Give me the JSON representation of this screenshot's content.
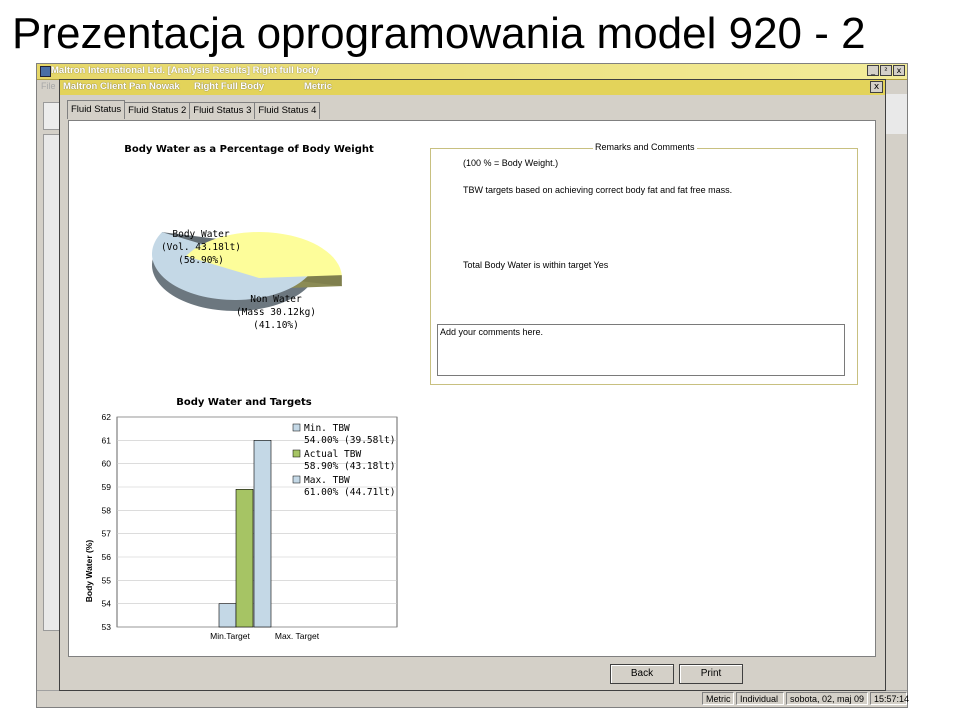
{
  "slide": {
    "title": "Prezentacja oprogramowania model 920 - 2"
  },
  "app": {
    "title": "Maltron International Ltd. [Analysis Results] Right full body",
    "menu_file": "File",
    "controls": {
      "minimize": "_",
      "restore": "²",
      "close": "x"
    }
  },
  "client_window": {
    "client": "Maltron Client Pan Nowak",
    "mode": "Right Full Body",
    "units": "Metric",
    "close": "x"
  },
  "tabs": [
    {
      "label": "Fluid Status",
      "active": true
    },
    {
      "label": "Fluid Status 2",
      "active": false
    },
    {
      "label": "Fluid Status 3",
      "active": false
    },
    {
      "label": "Fluid Status 4",
      "active": false
    }
  ],
  "chart_data": [
    {
      "type": "pie",
      "title": "Body Water as a Percentage of Body Weight",
      "slices": [
        {
          "label": "Body Water",
          "detail": "(Vol. 43.18lt)",
          "percent_text": "(58.90%)",
          "value": 58.9,
          "color": "#c4d8e6"
        },
        {
          "label": "Non Water",
          "detail": "(Mass 30.12kg)",
          "percent_text": "(41.10%)",
          "value": 41.1,
          "color": "#fdfd9a"
        }
      ]
    },
    {
      "type": "bar",
      "title": "Body Water and Targets",
      "ylabel": "Body Water (%)",
      "ylim": [
        53,
        62
      ],
      "yticks": [
        "62",
        "61",
        "60",
        "59",
        "58",
        "57",
        "56",
        "55",
        "54",
        "53"
      ],
      "categories": [
        "Min.Target",
        "Max. Target"
      ],
      "series": [
        {
          "name": "Min. TBW",
          "legend_value": "54.00% (39.58lt)",
          "value": 54.0,
          "color": "#c4d8e6"
        },
        {
          "name": "Actual TBW",
          "legend_value": "58.90% (43.18lt)",
          "value": 58.9,
          "color": "#a6c464"
        },
        {
          "name": "Max. TBW",
          "legend_value": "61.00% (44.71lt)",
          "value": 61.0,
          "color": "#c4d8e6"
        }
      ],
      "grid": true
    }
  ],
  "remarks": {
    "legend": "Remarks and Comments",
    "line1": "(100 % = Body Weight.)",
    "line2": "TBW targets based on achieving correct body fat and fat free mass.",
    "line3": "Total Body Water is within target Yes",
    "comments_placeholder": "Add your comments here."
  },
  "buttons": {
    "back": "Back",
    "print": "Print"
  },
  "statusbar": {
    "units": "Metric",
    "mode": "Individual",
    "date": "sobota, 02, maj 09",
    "time": "15:57:14"
  }
}
